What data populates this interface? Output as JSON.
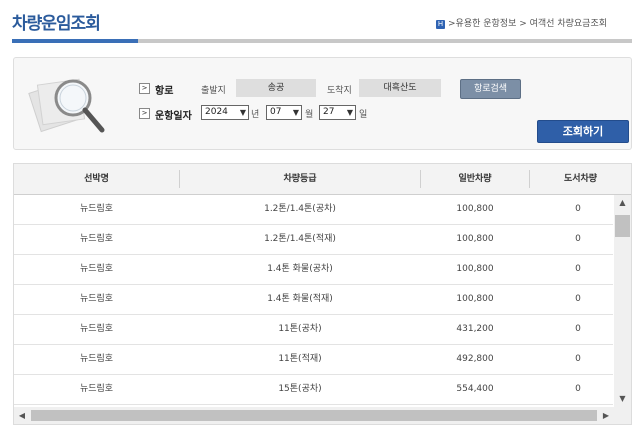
{
  "page_title": "차량운임조회",
  "breadcrumb": {
    "home_glyph": "H",
    "path": ">유용한 운항정보 > 여객선 차량요금조회"
  },
  "search": {
    "route_label": "항로",
    "departure_label": "출발지",
    "departure_value": "송공",
    "arrival_label": "도착지",
    "arrival_value": "대흑산도",
    "route_search_button": "항로검색",
    "date_label": "운항일자",
    "year": "2024",
    "year_unit": "년",
    "month": "07",
    "month_unit": "월",
    "day": "27",
    "day_unit": "일",
    "submit_button": "조회하기"
  },
  "table": {
    "columns": [
      "선박명",
      "차량등급",
      "일반차량",
      "도서차량"
    ],
    "rows": [
      [
        "뉴드림호",
        "1.2톤/1.4톤(공차)",
        "100,800",
        "0"
      ],
      [
        "뉴드림호",
        "1.2톤/1.4톤(적재)",
        "100,800",
        "0"
      ],
      [
        "뉴드림호",
        "1.4톤 화물(공차)",
        "100,800",
        "0"
      ],
      [
        "뉴드림호",
        "1.4톤 화물(적재)",
        "100,800",
        "0"
      ],
      [
        "뉴드림호",
        "11톤(공차)",
        "431,200",
        "0"
      ],
      [
        "뉴드림호",
        "11톤(적재)",
        "492,800",
        "0"
      ],
      [
        "뉴드림호",
        "15톤(공차)",
        "554,400",
        "0"
      ]
    ]
  },
  "colors": {
    "title": "#2b5b9c",
    "accent_bar": "#3a6fb7",
    "submit_button": "#2f5fa8",
    "route_button": "#7c8fa6"
  },
  "icons": [
    "magnifier-illustration",
    "arrow-box-icon",
    "chevron-down-icon",
    "scroll-arrow-icon"
  ]
}
